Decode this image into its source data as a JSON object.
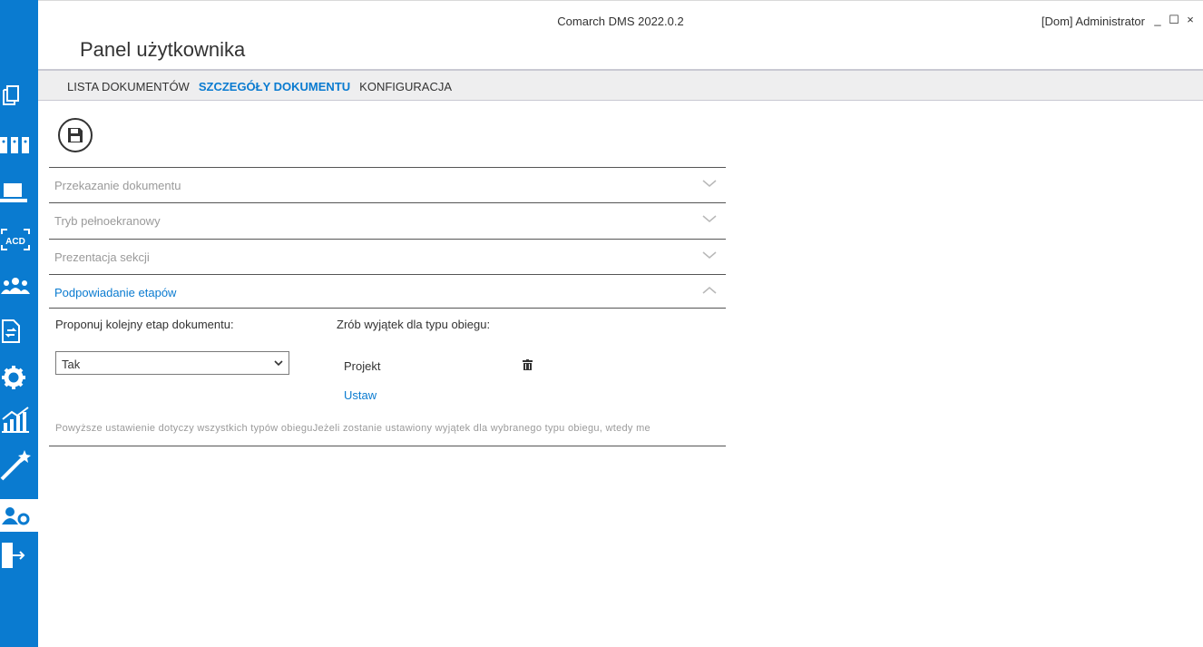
{
  "window": {
    "app_title": "Comarch DMS 2022.0.2",
    "user_label": "[Dom]  Administrator",
    "buttons": {
      "minimize": "_",
      "maximize": "☐",
      "close": "×"
    }
  },
  "page": {
    "title": "Panel użytkownika"
  },
  "tabs": [
    {
      "label": "LISTA DOKUMENTÓW",
      "active": false
    },
    {
      "label": "SZCZEGÓŁY DOKUMENTU",
      "active": true
    },
    {
      "label": "KONFIGURACJA",
      "active": false
    }
  ],
  "sidebar": {
    "items": [
      {
        "icon": "documents-icon",
        "active": false
      },
      {
        "icon": "binders-icon",
        "active": false
      },
      {
        "icon": "laptop-icon",
        "active": false
      },
      {
        "icon": "ocr-acd-icon",
        "label": "ACD",
        "active": false
      },
      {
        "icon": "users-icon",
        "active": false
      },
      {
        "icon": "document-refresh-icon",
        "active": false
      },
      {
        "icon": "gear-icon",
        "active": false
      },
      {
        "icon": "chart-icon",
        "active": false
      },
      {
        "icon": "magic-wand-icon",
        "active": false
      },
      {
        "icon": "user-settings-icon",
        "active": true
      },
      {
        "icon": "logout-door-icon",
        "active": false
      }
    ]
  },
  "toolbar": {
    "save_icon": "save-icon"
  },
  "sections": [
    {
      "label": "Przekazanie dokumentu",
      "expanded": false
    },
    {
      "label": "Tryb pełnoekranowy",
      "expanded": false
    },
    {
      "label": "Prezentacja sekcji",
      "expanded": false
    },
    {
      "label": "Podpowiadanie etapów",
      "expanded": true
    }
  ],
  "hints": {
    "propose_label": "Proponuj kolejny etap dokumentu:",
    "propose_value": "Tak",
    "exception_label": "Zrób wyjątek dla typu obiegu:",
    "exception_item": "Projekt",
    "set_link": "Ustaw",
    "note": "Powyższe ustawienie dotyczy wszystkich typów obieguJeżeli zostanie ustawiony wyjątek dla wybranego typu obiegu, wtedy me"
  },
  "colors": {
    "accent": "#0a7bd0",
    "sidebar": "#0a7bd0",
    "muted_text": "#9a9a9a",
    "tabs_bg": "#eeeeef"
  }
}
